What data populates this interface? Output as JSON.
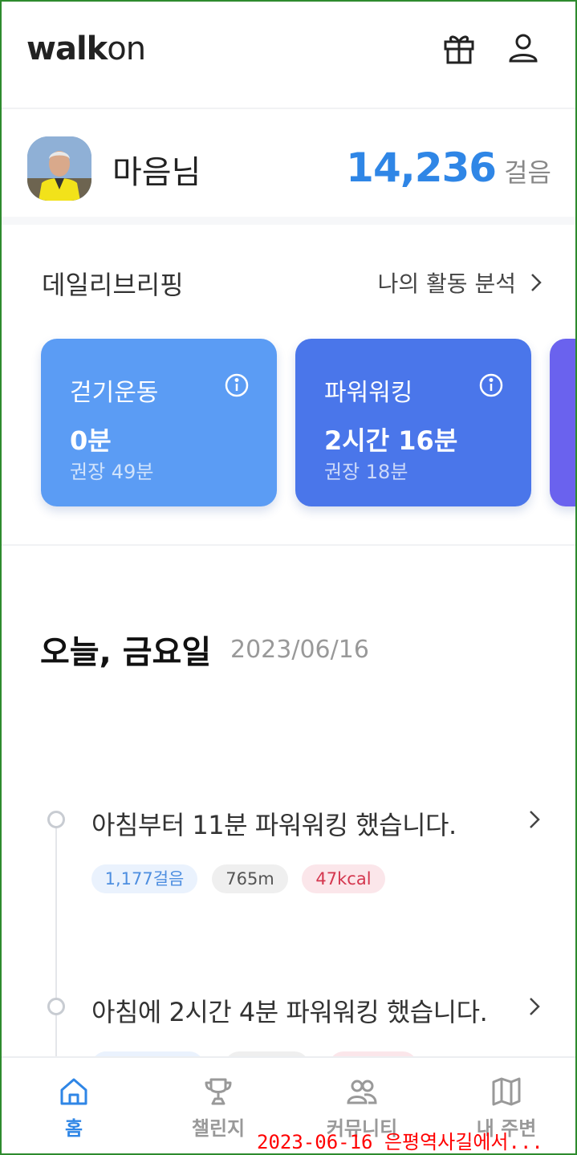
{
  "app": {
    "logo_bold": "walk",
    "logo_light": "on"
  },
  "header": {
    "gift_icon": "gift-icon",
    "profile_icon": "user-icon"
  },
  "profile": {
    "name": "마음님",
    "steps": "14,236",
    "steps_unit": "걸음"
  },
  "briefing": {
    "title": "데일리브리핑",
    "analysis_link": "나의 활동 분석",
    "cards": [
      {
        "label": "걷기운동",
        "value": "0분",
        "recommended": "권장 49분",
        "color": "#5b9cf4"
      },
      {
        "label": "파워워킹",
        "value": "2시간 16분",
        "recommended": "권장 18분",
        "color": "#4a76ea"
      }
    ],
    "partial_card_color": "#6a62ee"
  },
  "today": {
    "title": "오늘, 금요일",
    "date": "2023/06/16"
  },
  "timeline": [
    {
      "text": "아침부터 11분 파워워킹 했습니다.",
      "steps": "1,177걸음",
      "distance": "765m",
      "kcal": "47kcal"
    },
    {
      "text": "아침에 2시간 4분 파워워킹 했습니다."
    }
  ],
  "nav": [
    {
      "label": "홈",
      "icon": "home-icon",
      "active": true
    },
    {
      "label": "챌린지",
      "icon": "trophy-icon",
      "active": false
    },
    {
      "label": "커뮤니티",
      "icon": "community-icon",
      "active": false
    },
    {
      "label": "내 주변",
      "icon": "map-icon",
      "active": false
    }
  ],
  "colors": {
    "accent": "#2f86e6",
    "kcal": "#d4364e"
  },
  "watermark": "2023-06-16 은평역사길에서..."
}
